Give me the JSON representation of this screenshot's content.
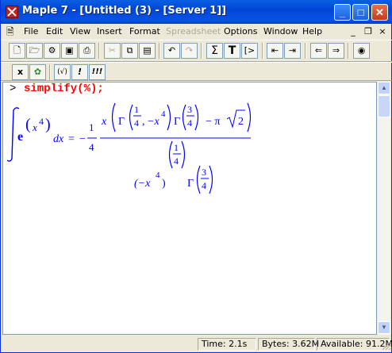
{
  "window": {
    "title": "Maple 7  - [Untitled (3) - [Server 1]]"
  },
  "title_buttons": {
    "minimize": "_",
    "maximize": "□",
    "close": "✕"
  },
  "menubar": {
    "items": [
      "File",
      "Edit",
      "View",
      "Insert",
      "Format",
      "Spreadsheet",
      "Options",
      "Window",
      "Help"
    ],
    "disabled": [
      "Spreadsheet"
    ],
    "mdi": {
      "minimize": "_",
      "restore": "🗗",
      "close": "×"
    }
  },
  "toolbar": {
    "buttons": [
      {
        "name": "new",
        "icon": "new-document-icon",
        "glyph": "🗋"
      },
      {
        "name": "open",
        "icon": "open-folder-icon",
        "glyph": "🗁"
      },
      {
        "name": "open-url",
        "icon": "open-url-icon",
        "glyph": "⚙"
      },
      {
        "name": "save",
        "icon": "save-icon",
        "glyph": "💾"
      },
      {
        "name": "print",
        "icon": "print-icon",
        "glyph": "⎙"
      },
      {
        "name": "cut",
        "icon": "cut-icon",
        "glyph": "✂"
      },
      {
        "name": "copy",
        "icon": "copy-icon",
        "glyph": "⧉"
      },
      {
        "name": "paste",
        "icon": "paste-icon",
        "glyph": "📋"
      },
      {
        "name": "undo",
        "icon": "undo-icon",
        "glyph": "↶"
      },
      {
        "name": "redo",
        "icon": "redo-icon",
        "glyph": "↷"
      },
      {
        "name": "sum",
        "icon": "sigma-icon",
        "glyph": "Σ"
      },
      {
        "name": "text",
        "icon": "text-icon",
        "glyph": "T"
      },
      {
        "name": "input",
        "icon": "input-prompt-icon",
        "glyph": "[>"
      },
      {
        "name": "indent",
        "icon": "outdent-icon",
        "glyph": "⇤"
      },
      {
        "name": "outdent",
        "icon": "indent-icon",
        "glyph": "⇥"
      },
      {
        "name": "back",
        "icon": "back-arrow-icon",
        "glyph": "⇐"
      },
      {
        "name": "forward",
        "icon": "forward-arrow-icon",
        "glyph": "⇒"
      },
      {
        "name": "stop",
        "icon": "stop-icon",
        "glyph": "◉"
      }
    ],
    "second": [
      {
        "name": "interrupt",
        "icon": "x-icon",
        "glyph": "x"
      },
      {
        "name": "maple-leaf",
        "icon": "maple-leaf-icon",
        "glyph": "✿"
      },
      {
        "name": "execute",
        "icon": "check-icon",
        "glyph": "(√)"
      },
      {
        "name": "execute-one",
        "icon": "exclamation-icon",
        "glyph": "!"
      },
      {
        "name": "execute-all",
        "icon": "triple-exclamation-icon",
        "glyph": "!!!"
      }
    ]
  },
  "worksheet": {
    "prompt": ">",
    "command": "simplify(%);",
    "output": {
      "lhs_base": "e",
      "lhs_exp_var": "x",
      "lhs_exp_pow": "4",
      "dx": "dx",
      "equals": "=",
      "minus": "−",
      "frac_num": "1",
      "frac_den": "4",
      "x": "x",
      "gamma": "Γ",
      "g1_num": "1",
      "g1_den": "4",
      "comma": ",",
      "neg_x": "−x",
      "pow4": "4",
      "g2_num": "3",
      "g2_den": "4",
      "pi_term": "− π",
      "sqrt_arg": "2",
      "den_base": "(−x",
      "den_pow_close": ")",
      "den_exp_num": "1",
      "den_exp_den": "4"
    }
  },
  "status": {
    "time": "Time:  2.1s",
    "bytes": "Bytes: 3.62M",
    "available": "Available: 91.2M"
  },
  "colors": {
    "command": "#ff0000",
    "math": "#0000ff",
    "titlebar": "#0054e3"
  }
}
